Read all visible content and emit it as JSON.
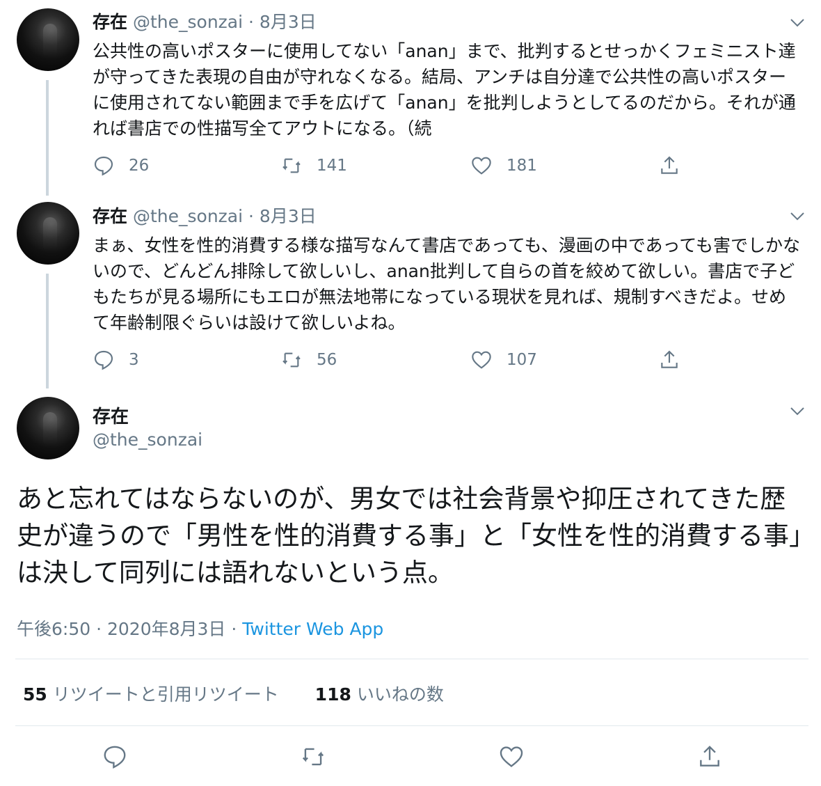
{
  "tweets": [
    {
      "name": "存在",
      "handle": "@the_sonzai",
      "sep": "·",
      "date": "8月3日",
      "text": "公共性の高いポスターに使用してない「anan」まで、批判するとせっかくフェミニスト達が守ってきた表現の自由が守れなくなる。結局、アンチは自分達で公共性の高いポスターに使用されてない範囲まで手を広げて「anan」を批判しようとしてるのだから。それが通れば書店での性描写全てアウトになる。（続",
      "replies": "26",
      "retweets": "141",
      "likes": "181"
    },
    {
      "name": "存在",
      "handle": "@the_sonzai",
      "sep": "·",
      "date": "8月3日",
      "text": "まぁ、女性を性的消費する様な描写なんて書店であっても、漫画の中であっても害でしかないので、どんどん排除して欲しいし、anan批判して自らの首を絞めて欲しい。書店で子どもたちが見る場所にもエロが無法地帯になっている現状を見れば、規制すべきだよ。せめて年齢制限ぐらいは設けて欲しいよね。",
      "replies": "3",
      "retweets": "56",
      "likes": "107"
    }
  ],
  "main": {
    "name": "存在",
    "handle": "@the_sonzai",
    "text": "あと忘れてはならないのが、男女では社会背景や抑圧されてきた歴史が違うので「男性を性的消費する事」と「女性を性的消費する事」は決して同列には語れないという点。",
    "time": "午後6:50 · 2020年8月3日 · ",
    "source": "Twitter Web App",
    "retweet_count": "55",
    "retweet_label": "リツイートと引用リツイート",
    "like_count": "118",
    "like_label": "いいねの数"
  },
  "colors": {
    "text": "#14171a",
    "secondary": "#657786",
    "link": "#1b95e0",
    "divider": "#e1e8ed",
    "thread_line": "#ccd6dd"
  },
  "icons": [
    "reply-icon",
    "retweet-icon",
    "like-icon",
    "share-icon",
    "chevron-down-icon"
  ]
}
